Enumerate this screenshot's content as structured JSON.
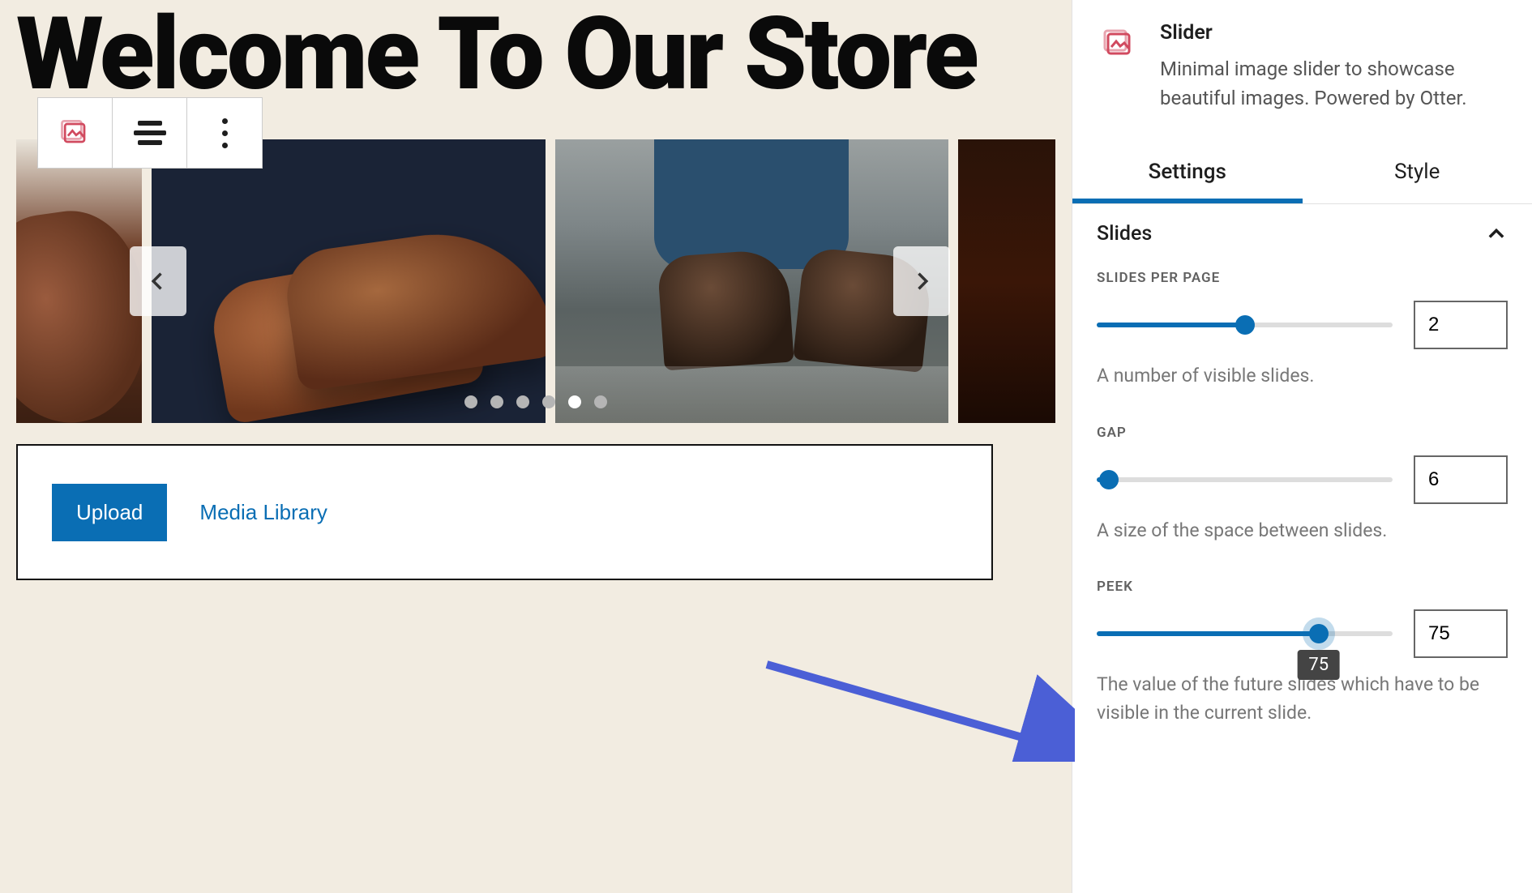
{
  "hero": {
    "title": "Welcome To Our Store"
  },
  "toolbar": {
    "block_icon": "slider-icon",
    "align_icon": "align-icon",
    "more_icon": "more-icon"
  },
  "slider_nav": {
    "prev": "Previous",
    "next": "Next",
    "dot_count": 6,
    "active_dot": 4
  },
  "media_panel": {
    "upload_label": "Upload",
    "library_label": "Media Library"
  },
  "sidebar": {
    "block_name": "Slider",
    "block_description": "Minimal image slider to showcase beautiful images. Powered by Otter.",
    "tabs": {
      "settings": "Settings",
      "style": "Style",
      "active": "settings"
    },
    "section_title": "Slides",
    "controls": {
      "slides_per_page": {
        "label": "SLIDES PER PAGE",
        "value": "2",
        "percent": 50,
        "help": "A number of visible slides."
      },
      "gap": {
        "label": "GAP",
        "value": "6",
        "percent": 4,
        "help": "A size of the space between slides."
      },
      "peek": {
        "label": "PEEK",
        "value": "75",
        "percent": 75,
        "tooltip": "75",
        "help": "The value of the future slides which have to be visible in the current slide."
      }
    }
  }
}
